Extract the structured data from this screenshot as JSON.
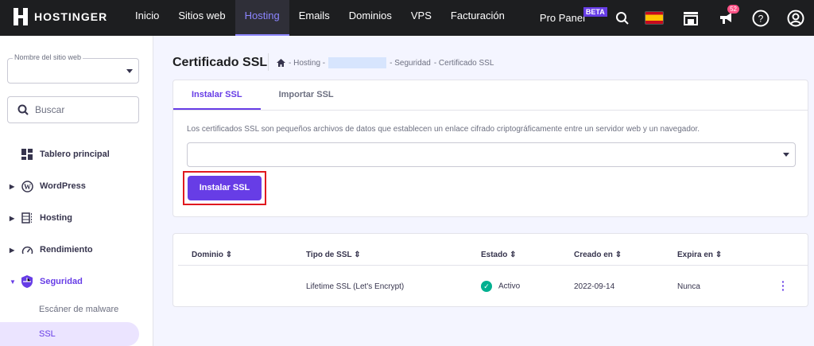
{
  "topbar": {
    "brand": "HOSTINGER",
    "nav": [
      "Inicio",
      "Sitios web",
      "Hosting",
      "Emails",
      "Dominios",
      "VPS",
      "Facturación"
    ],
    "active": "Hosting",
    "pro_panel": "Pro Panel",
    "beta": "BETA",
    "notifications": "52"
  },
  "sidebar": {
    "site_label": "Nombre del sitio web",
    "search_placeholder": "Buscar",
    "items": [
      {
        "label": "Tablero principal"
      },
      {
        "label": "WordPress"
      },
      {
        "label": "Hosting"
      },
      {
        "label": "Rendimiento"
      },
      {
        "label": "Seguridad"
      }
    ],
    "sub": [
      "Escáner de malware",
      "SSL"
    ]
  },
  "page": {
    "title": "Certificado SSL",
    "breadcrumb": [
      "- Hosting -",
      "- Seguridad",
      "- Certificado SSL"
    ]
  },
  "install": {
    "tabs": [
      "Instalar SSL",
      "Importar SSL"
    ],
    "description": "Los certificados SSL son pequeños archivos de datos que establecen un enlace cifrado criptográficamente entre un servidor web y un navegador.",
    "button": "Instalar SSL"
  },
  "table": {
    "headers": [
      "Dominio",
      "Tipo de SSL",
      "Estado",
      "Creado en",
      "Expira en"
    ],
    "rows": [
      {
        "domain": "",
        "type": "Lifetime SSL (Let's Encrypt)",
        "status": "Activo",
        "created": "2022-09-14",
        "expires": "Nunca"
      }
    ]
  },
  "colors": {
    "accent": "#673de6",
    "topbar": "#1d1e20",
    "success": "#00b090"
  }
}
